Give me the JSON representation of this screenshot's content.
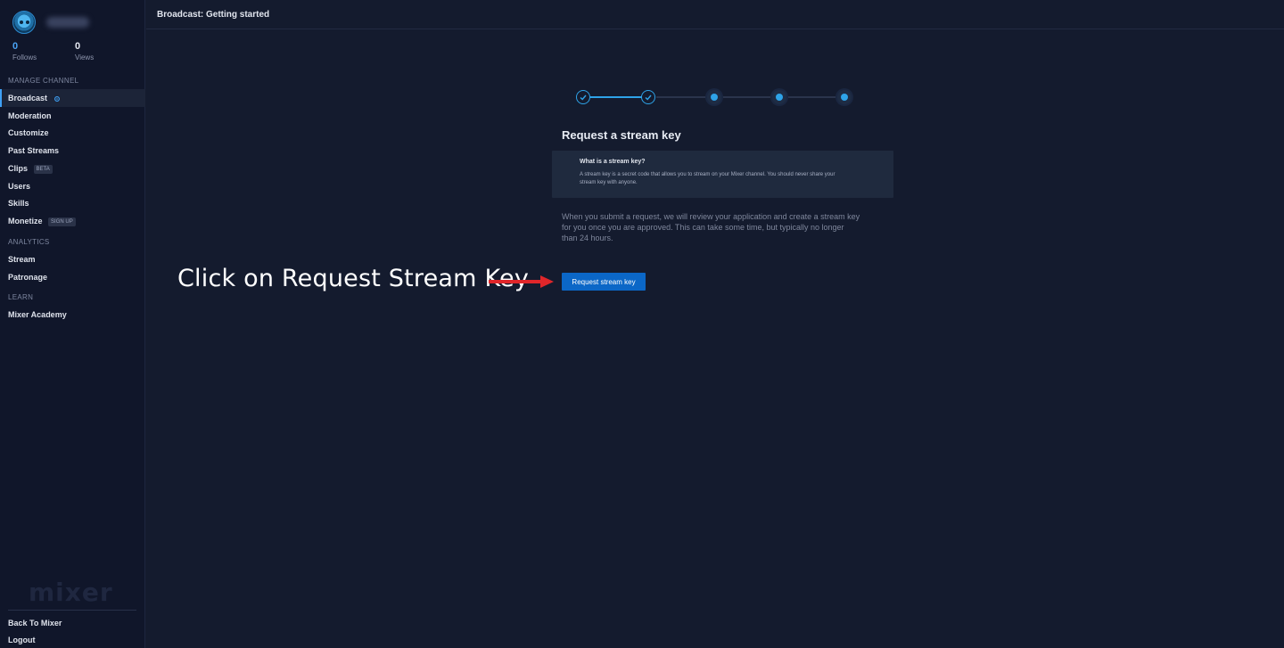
{
  "profile": {
    "username": "username",
    "followers_count": "0",
    "followers_label": "Follows",
    "views_count": "0",
    "views_label": "Views"
  },
  "sidebar": {
    "manage_label": "Manage Channel",
    "manage_items": [
      {
        "label": "Broadcast"
      },
      {
        "label": "Moderation"
      },
      {
        "label": "Customize"
      },
      {
        "label": "Past Streams"
      },
      {
        "label": "Clips",
        "badge": "BETA"
      },
      {
        "label": "Users"
      },
      {
        "label": "Skills"
      },
      {
        "label": "Monetize",
        "badge": "SIGN UP"
      }
    ],
    "analytics_label": "Analytics",
    "analytics_items": [
      {
        "label": "Stream"
      },
      {
        "label": "Patronage"
      }
    ],
    "learn_label": "Learn",
    "learn_items": [
      {
        "label": "Mixer Academy"
      }
    ],
    "logo": "mixer",
    "footer_items": [
      {
        "label": "Back To Mixer"
      },
      {
        "label": "Logout"
      }
    ]
  },
  "topbar": {
    "title": "Broadcast: Getting started"
  },
  "stepper": {
    "total": 5,
    "completed": 2
  },
  "main": {
    "heading": "Request a stream key",
    "info_question": "What is a stream key?",
    "info_answer": "A stream key is a secret code that allows you to stream on your Mixer channel. You should never share your stream key with anyone.",
    "body": "When you submit a request, we will review your application and create a stream key for you once you are approved. This can take some time, but typically no longer than 24 hours.",
    "button_label": "Request stream key"
  },
  "annotation": {
    "text": "Click on Request Stream Key",
    "arrow_color": "#e0262a"
  },
  "colors": {
    "accent": "#2ea3e8",
    "button": "#0b67c7",
    "background": "#141b2e",
    "sidebar": "#10162a"
  }
}
